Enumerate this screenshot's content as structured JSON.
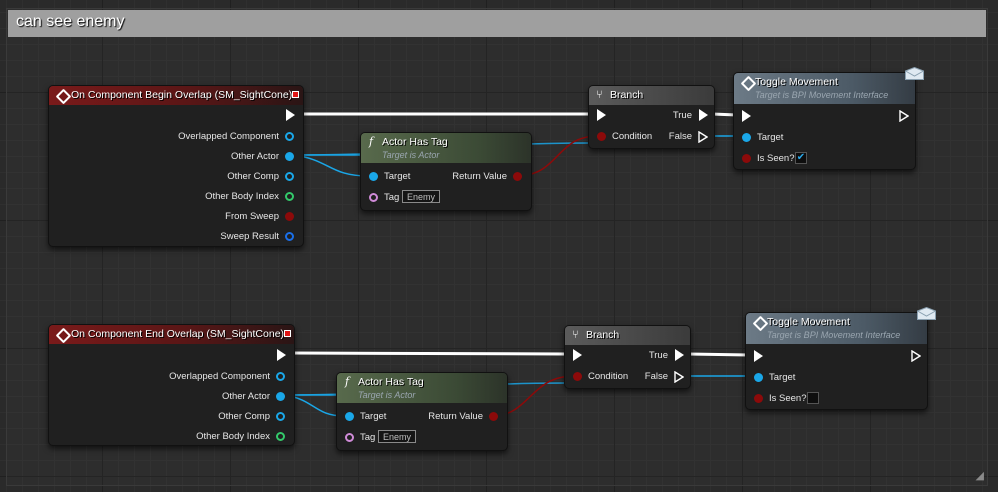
{
  "comment": {
    "title": "can see enemy"
  },
  "events": [
    {
      "title": "On Component Begin Overlap (SM_SightCone)",
      "pins": [
        "Overlapped Component",
        "Other Actor",
        "Other Comp",
        "Other Body Index",
        "From Sweep",
        "Sweep Result"
      ]
    },
    {
      "title": "On Component End Overlap (SM_SightCone)",
      "pins": [
        "Overlapped Component",
        "Other Actor",
        "Other Comp",
        "Other Body Index"
      ]
    }
  ],
  "actor_has_tag": {
    "title": "Actor Has Tag",
    "subtitle": "Target is Actor",
    "target_label": "Target",
    "tag_label": "Tag",
    "tag_value": "Enemy",
    "return_label": "Return Value"
  },
  "branch": {
    "title": "Branch",
    "condition_label": "Condition",
    "true_label": "True",
    "false_label": "False"
  },
  "toggle": {
    "title": "Toggle Movement",
    "subtitle": "Target is BPI Movement Interface",
    "target_label": "Target",
    "is_seen_label": "Is Seen?"
  },
  "toggle_states": [
    {
      "is_seen": true,
      "check_glyph": "✔"
    },
    {
      "is_seen": false,
      "check_glyph": ""
    }
  ],
  "colors": {
    "event_header": "#7a1a1a",
    "function_header": "#586a4c",
    "interface_header": "#6c7a86",
    "object_pin": "#1aa7e8",
    "bool_pin": "#8c0a0a",
    "int_pin": "#33c96a",
    "name_pin": "#d08bd8",
    "exec_wire": "#ffffff"
  }
}
